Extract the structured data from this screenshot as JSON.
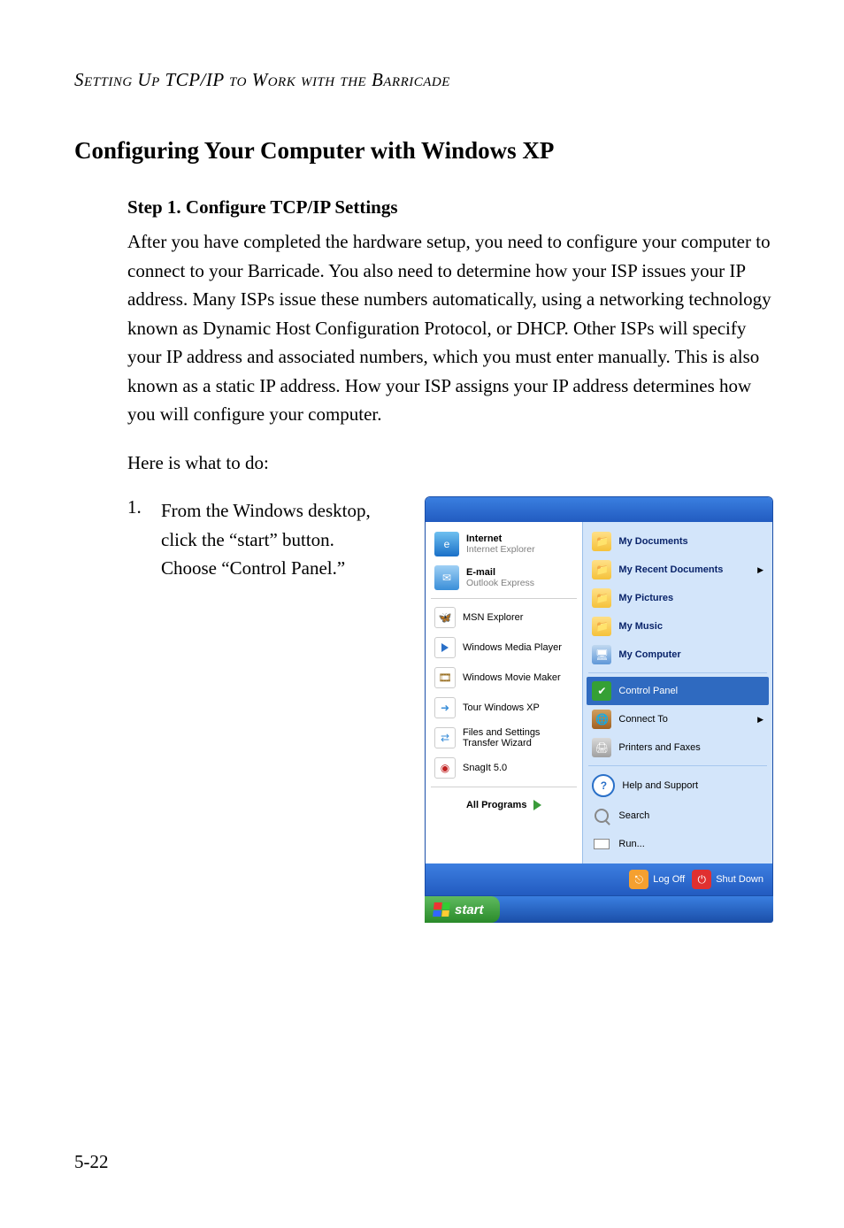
{
  "running_head": "Setting Up TCP/IP to Work with the Barricade",
  "section_title": "Configuring Your Computer with Windows XP",
  "step_title": "Step 1. Configure TCP/IP Settings",
  "paragraph": "After you have completed the hardware setup, you need to configure your computer to connect to your Barricade. You also need to determine how your ISP issues your IP address. Many ISPs issue these numbers automatically, using a networking technology known as Dynamic Host Configuration Protocol, or DHCP. Other ISPs will specify your IP address and associated numbers, which you must enter manually. This is also known as a static IP address. How your ISP assigns your IP address determines how you will configure your computer.",
  "lead_in": "Here is what to do:",
  "list": {
    "num": "1.",
    "text": "From the Windows desktop, click the “start” button. Choose “Control Panel.”"
  },
  "start_menu": {
    "pinned": [
      {
        "title": "Internet",
        "subtitle": "Internet Explorer"
      },
      {
        "title": "E-mail",
        "subtitle": "Outlook Express"
      }
    ],
    "recent": [
      "MSN Explorer",
      "Windows Media Player",
      "Windows Movie Maker",
      "Tour Windows XP",
      "Files and Settings Transfer Wizard",
      "SnagIt 5.0"
    ],
    "all_programs": "All Programs",
    "right": [
      {
        "label": "My Documents",
        "bold": true
      },
      {
        "label": "My Recent Documents",
        "bold": true,
        "submenu": true
      },
      {
        "label": "My Pictures",
        "bold": true
      },
      {
        "label": "My Music",
        "bold": true
      },
      {
        "label": "My Computer",
        "bold": true
      },
      {
        "label": "Control Panel",
        "hover": true
      },
      {
        "label": "Connect To",
        "submenu": true
      },
      {
        "label": "Printers and Faxes"
      },
      {
        "label": "Help and Support"
      },
      {
        "label": "Search"
      },
      {
        "label": "Run..."
      }
    ],
    "footer": {
      "logoff": "Log Off",
      "shutdown": "Shut Down"
    },
    "start_button": "start"
  },
  "page_number": "5-22"
}
